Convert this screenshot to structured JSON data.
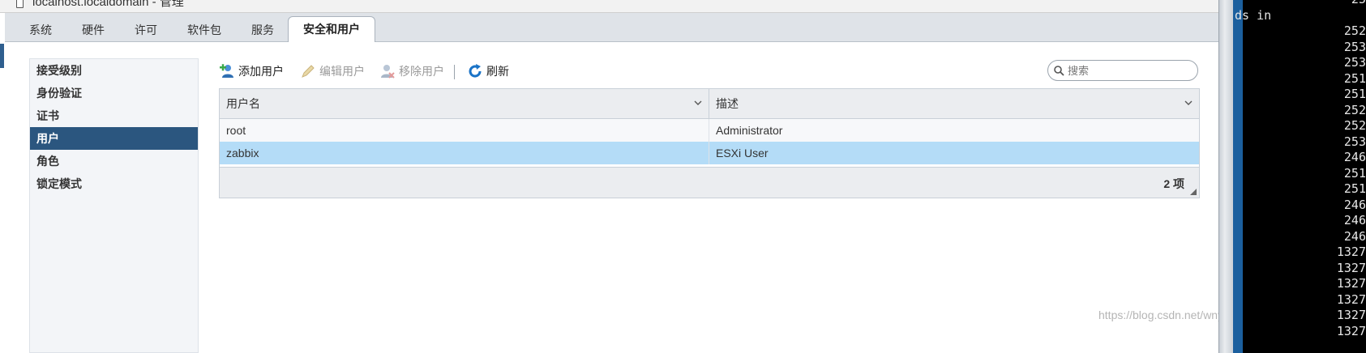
{
  "window": {
    "title": "localhost.localdomain - 管理"
  },
  "tabs": [
    {
      "label": "系统"
    },
    {
      "label": "硬件"
    },
    {
      "label": "许可"
    },
    {
      "label": "软件包"
    },
    {
      "label": "服务"
    },
    {
      "label": "安全和用户",
      "active": true
    }
  ],
  "sidebar": {
    "items": [
      {
        "label": "接受级别"
      },
      {
        "label": "身份验证"
      },
      {
        "label": "证书"
      },
      {
        "label": "用户",
        "selected": true
      },
      {
        "label": "角色"
      },
      {
        "label": "锁定模式"
      }
    ]
  },
  "toolbar": {
    "add_user": "添加用户",
    "edit_user": "编辑用户",
    "remove_user": "移除用户",
    "refresh": "刷新"
  },
  "search": {
    "placeholder": "搜索"
  },
  "grid": {
    "columns": [
      "用户名",
      "描述"
    ],
    "rows": [
      {
        "username": "root",
        "description": "Administrator"
      },
      {
        "username": "zabbix",
        "description": "ESXi User",
        "selected": true
      }
    ],
    "count_label": "2 项"
  },
  "terminal": {
    "lines": [
      " 25",
      "ds in",
      " 252",
      " 253",
      " 253",
      " 251",
      " 251",
      " 252",
      " 252",
      " 253",
      " 246",
      " 251",
      " 251",
      " 246",
      " 246",
      " 246",
      "1327",
      "1327",
      "1327",
      "1327",
      "1327",
      "1327"
    ]
  },
  "watermark": "https://blog.csdn.net/wnyAhuan",
  "colors": {
    "selected_nav": "#2b567f",
    "selected_row": "#b4dcf7",
    "tabbar": "#dfe3e8",
    "terminal_bg": "#000000",
    "terminal_stripe": "#1b5f9e"
  }
}
